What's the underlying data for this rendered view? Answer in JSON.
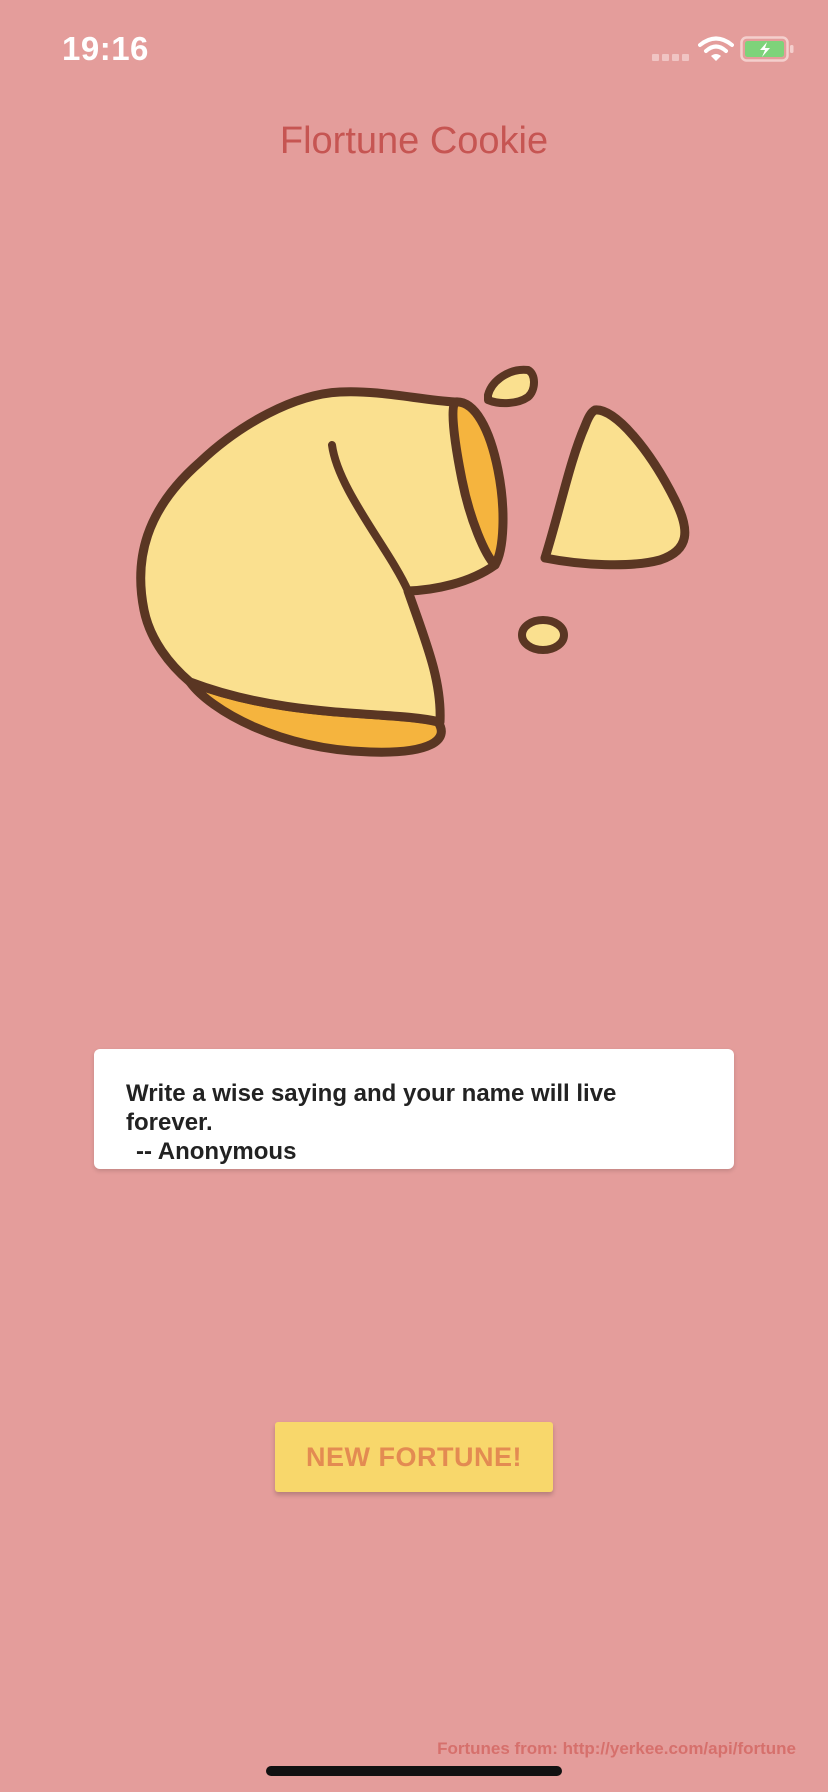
{
  "status_bar": {
    "time": "19:16"
  },
  "header": {
    "title": "Flortune Cookie"
  },
  "fortune": {
    "text": "Write a wise saying and your name will live forever.",
    "author": "-- Anonymous"
  },
  "actions": {
    "new_fortune_label": "NEW FORTUNE!"
  },
  "footer": {
    "attribution": "Fortunes from: http://yerkee.com/api/fortune"
  },
  "colors": {
    "background": "#e49d9b",
    "title": "#c65552",
    "button_bg": "#f8d76b",
    "button_text": "#e38b52",
    "cookie_fill": "#fae08f",
    "cookie_inner": "#f5b43e",
    "cookie_outline": "#5a3623",
    "battery_fill": "#7ed37a"
  },
  "icons": [
    "signal-icon",
    "wifi-icon",
    "battery-charging-icon",
    "fortune-cookie-illustration"
  ]
}
